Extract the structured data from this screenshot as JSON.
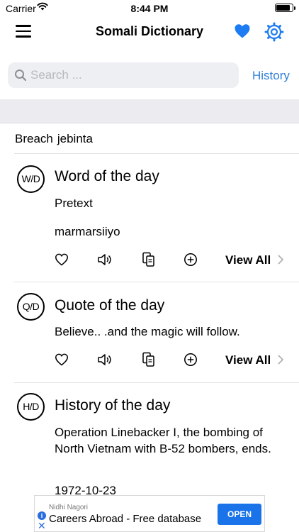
{
  "status": {
    "carrier": "Carrier",
    "time": "8:44 PM"
  },
  "nav": {
    "title": "Somali Dictionary"
  },
  "search": {
    "placeholder": "Search ...",
    "history_label": "History"
  },
  "recent": {
    "word": "Breach",
    "translation": "jebinta"
  },
  "word_of_day": {
    "badge": "W/D",
    "title": "Word of the day",
    "word": "Pretext",
    "translation": "marmarsiiyo",
    "view_all": "View All"
  },
  "quote_of_day": {
    "badge": "Q/D",
    "title": "Quote of the day",
    "text": "Believe.. .and the magic will follow.",
    "view_all": "View All"
  },
  "history_of_day": {
    "badge": "H/D",
    "title": "History of the day",
    "text": "Operation Linebacker I, the bombing of North Vietnam with B-52 bombers, ends.",
    "date": "1972-10-23"
  },
  "ad": {
    "advertiser": "Nidhi Nagori",
    "headline": "Careers Abroad - Free database",
    "cta": "OPEN"
  },
  "icons": {
    "menu": "hamburger-icon",
    "favorite": "heart-icon",
    "settings": "gear-icon",
    "search": "search-icon",
    "speak": "speaker-icon",
    "copy": "copy-icon",
    "add": "plus-circle-icon",
    "chevron": "chevron-right-icon"
  },
  "colors": {
    "accent": "#2f7fd8",
    "heart": "#1e7cf2",
    "ad_button": "#1a73e8"
  }
}
